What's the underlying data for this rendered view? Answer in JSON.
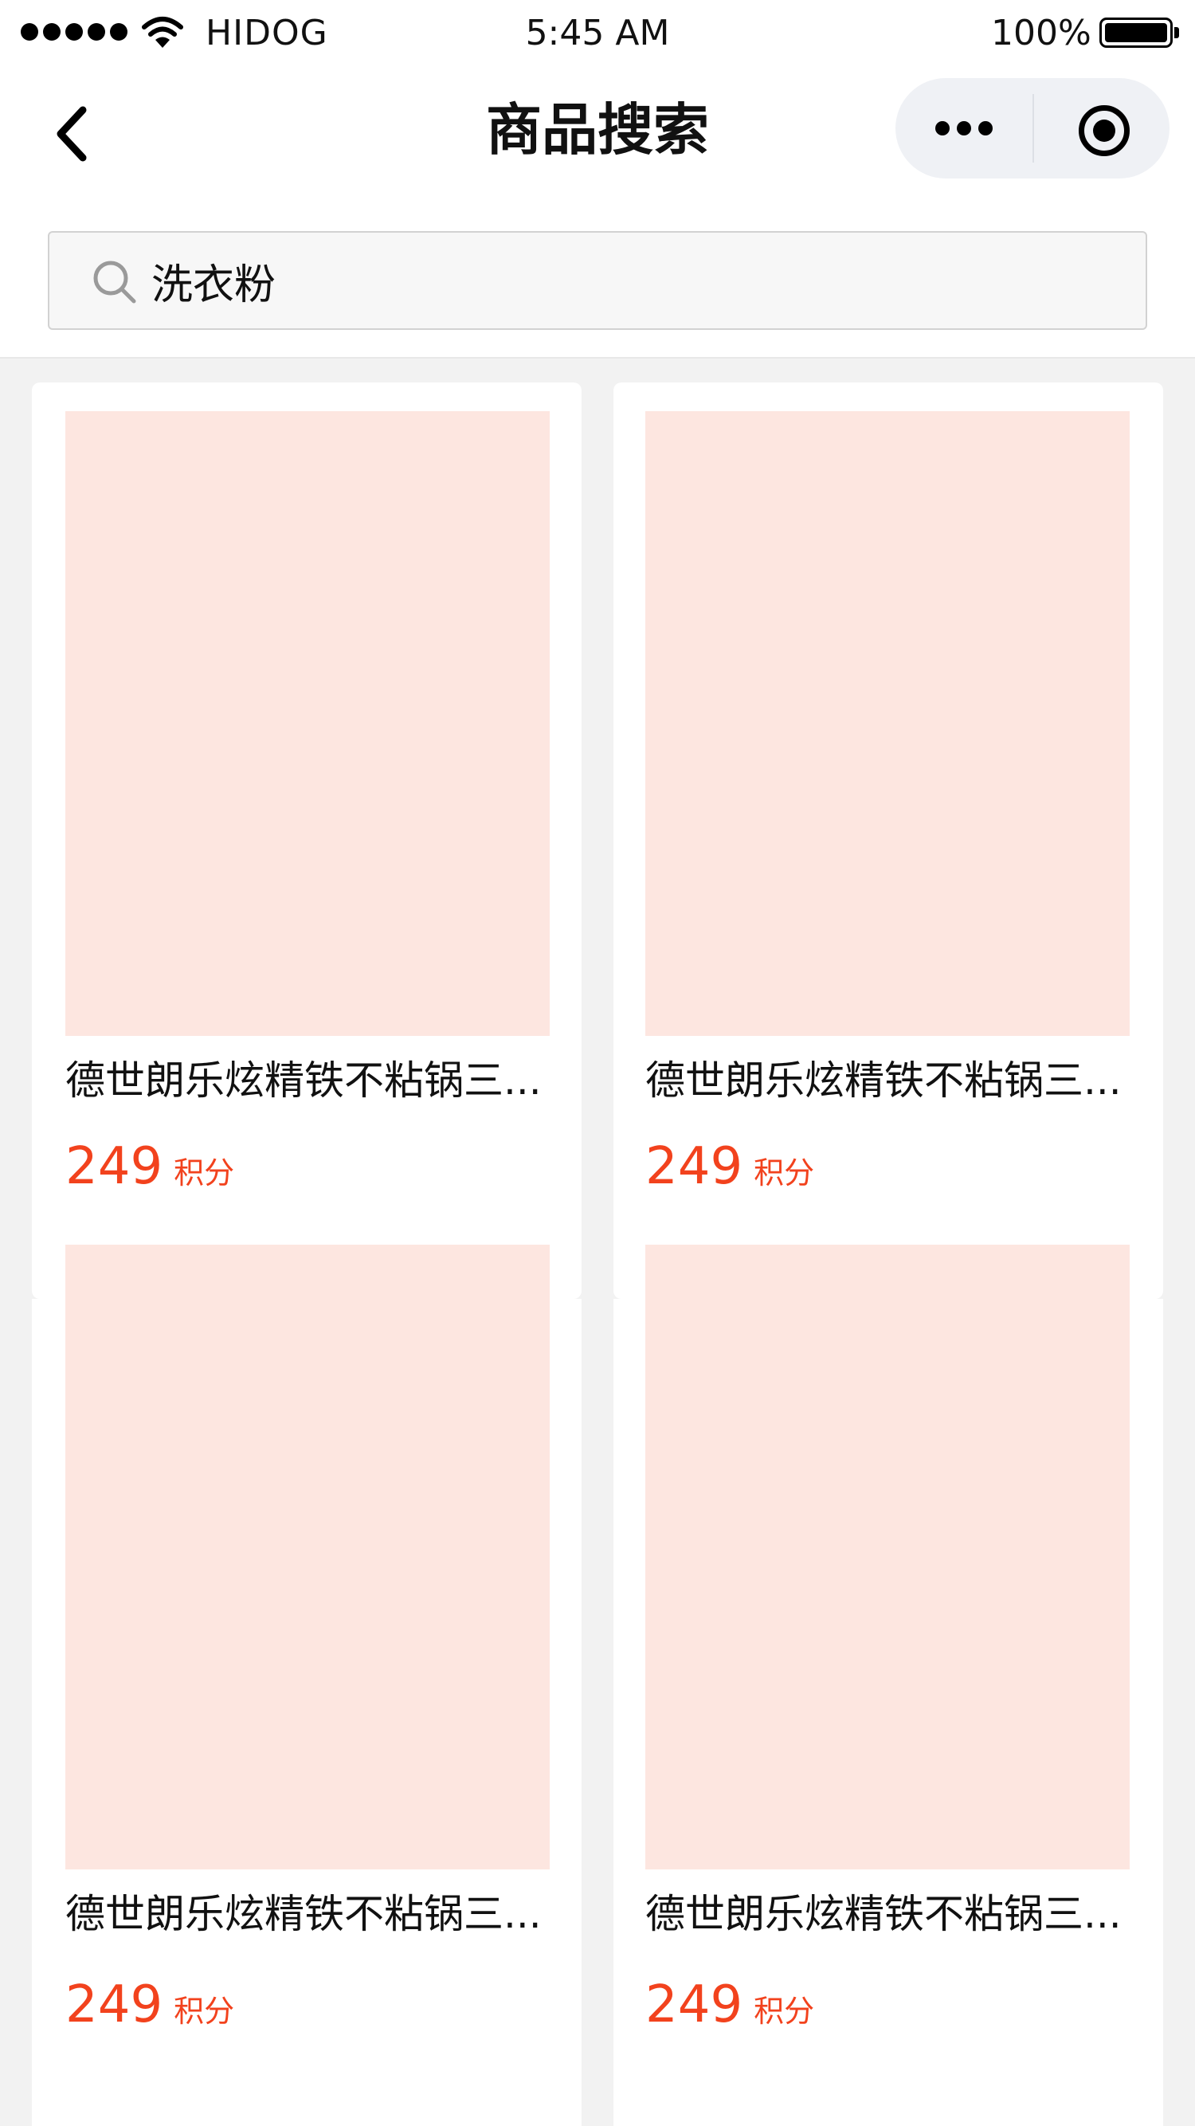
{
  "status_bar": {
    "carrier": "HIDOG",
    "time": "5:45 AM",
    "battery": "100%"
  },
  "nav": {
    "title": "商品搜索",
    "icons": [
      "chevron-left-icon",
      "more-icon",
      "close-circle-icon"
    ]
  },
  "search": {
    "value": "洗衣粉",
    "icon": "search-icon"
  },
  "products": [
    {
      "name": "德世朗乐炫精铁不粘锅三...",
      "price": "249",
      "unit": "积分"
    },
    {
      "name": "德世朗乐炫精铁不粘锅三...",
      "price": "249",
      "unit": "积分"
    },
    {
      "name": "德世朗乐炫精铁不粘锅三...",
      "price": "249",
      "unit": "积分"
    },
    {
      "name": "德世朗乐炫精铁不粘锅三...",
      "price": "249",
      "unit": "积分"
    }
  ],
  "colors": {
    "price": "#f2421d",
    "image_placeholder": "#fde6e0",
    "page_background": "#f2f2f2"
  }
}
